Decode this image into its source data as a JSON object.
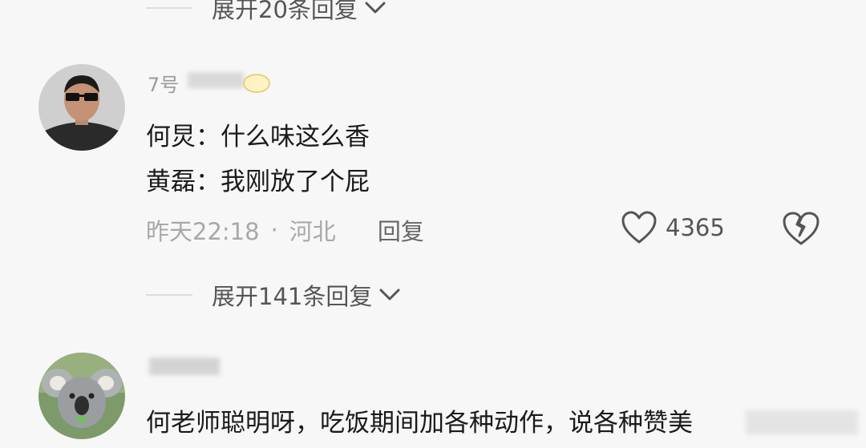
{
  "thread_top": {
    "expand_label": "展开20条回复"
  },
  "comment1": {
    "username_partial": "7号",
    "lines": [
      "何炅：什么味这么香",
      "黄磊：我刚放了个屁"
    ],
    "time": "昨天22:18",
    "separator": "·",
    "location": "河北",
    "reply_label": "回复",
    "likes": "4365",
    "expand_label": "展开141条回复"
  },
  "comment2": {
    "text": "何老师聪明呀，吃饭期间加各种动作，说各种赞美"
  },
  "icons": {
    "like": "heart-outline-icon",
    "dislike": "broken-heart-icon",
    "expand": "chevron-down-icon"
  },
  "colors": {
    "background": "#f7f7f7",
    "text": "#1a1a1a",
    "muted": "#a8a8a8"
  }
}
